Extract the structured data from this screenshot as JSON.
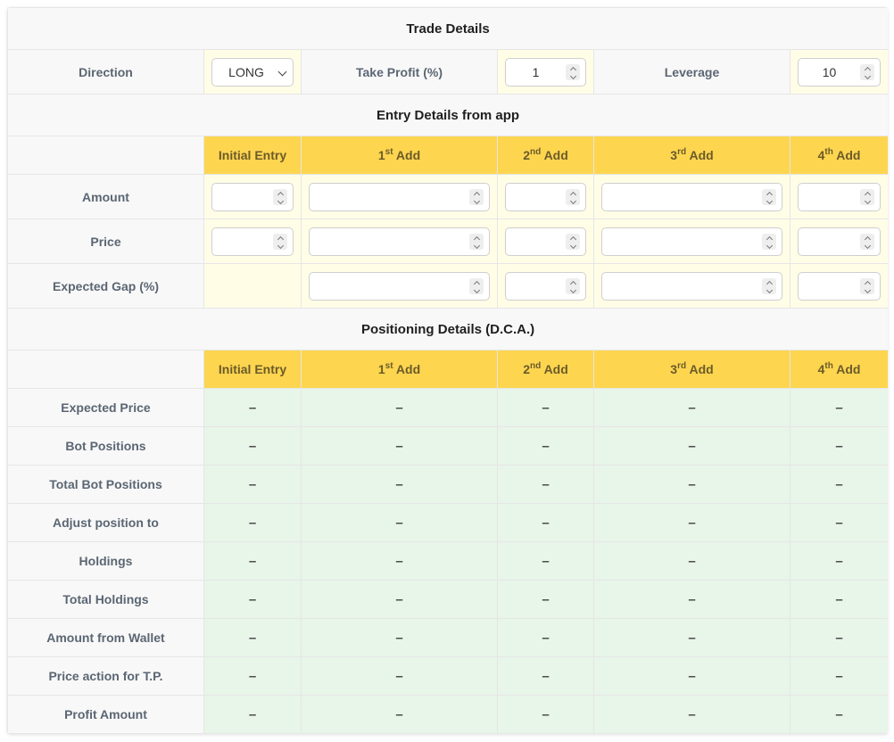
{
  "trade": {
    "title": "Trade Details",
    "direction_label": "Direction",
    "direction_value": "LONG",
    "take_profit_label": "Take Profit (%)",
    "take_profit_value": "1",
    "leverage_label": "Leverage",
    "leverage_value": "10"
  },
  "entry": {
    "title": "Entry Details from app",
    "columns": [
      {
        "base": "Initial Entry",
        "sup": "",
        "tail": ""
      },
      {
        "base": "1",
        "sup": "st",
        "tail": " Add"
      },
      {
        "base": "2",
        "sup": "nd",
        "tail": " Add"
      },
      {
        "base": "3",
        "sup": "rd",
        "tail": " Add"
      },
      {
        "base": "4",
        "sup": "th",
        "tail": " Add"
      }
    ],
    "rows": [
      "Amount",
      "Price",
      "Expected Gap (%)"
    ]
  },
  "positioning": {
    "title": "Positioning Details (D.C.A.)",
    "placeholder": "–",
    "rows": [
      "Expected Price",
      "Bot Positions",
      "Total Bot Positions",
      "Adjust position to",
      "Holdings",
      "Total Holdings",
      "Amount from Wallet",
      "Price action for T.P.",
      "Profit Amount"
    ]
  },
  "colors": {
    "header_yellow": "#fdd54f",
    "input_cream": "#fffde6",
    "output_green": "#e8f5e9",
    "label_gray": "#f8f8f8"
  },
  "icons": {
    "spinner": "spinner-icon",
    "dropdown": "chevron-down-icon"
  }
}
